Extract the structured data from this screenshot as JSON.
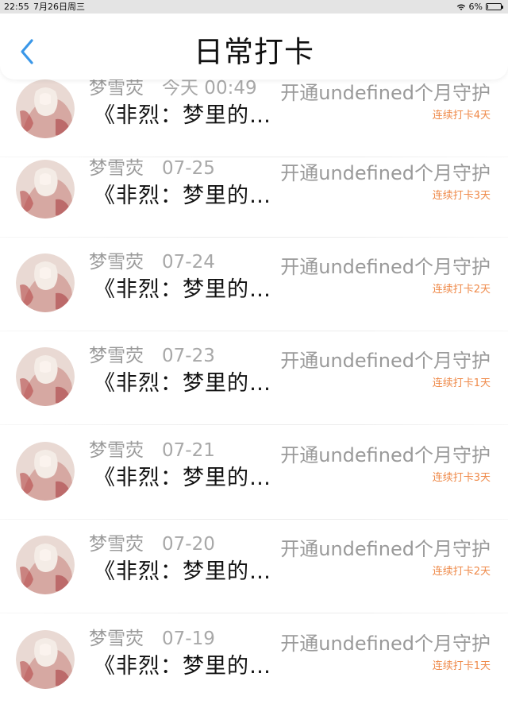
{
  "status_bar": {
    "time": "22:55",
    "date": "7月26日周三",
    "battery": "6%",
    "battery_level": 0.06
  },
  "nav": {
    "title": "日常打卡"
  },
  "entries": [
    {
      "name": "梦雪荧",
      "date": "今天 00:49",
      "title": "《非烈：梦里的…",
      "guard": "开通undefined个月守护",
      "streak": "连续打卡4天"
    },
    {
      "name": "梦雪荧",
      "date": "07-25",
      "title": "《非烈：梦里的…",
      "guard": "开通undefined个月守护",
      "streak": "连续打卡3天"
    },
    {
      "name": "梦雪荧",
      "date": "07-24",
      "title": "《非烈：梦里的…",
      "guard": "开通undefined个月守护",
      "streak": "连续打卡2天"
    },
    {
      "name": "梦雪荧",
      "date": "07-23",
      "title": "《非烈：梦里的…",
      "guard": "开通undefined个月守护",
      "streak": "连续打卡1天"
    },
    {
      "name": "梦雪荧",
      "date": "07-21",
      "title": "《非烈：梦里的…",
      "guard": "开通undefined个月守护",
      "streak": "连续打卡3天"
    },
    {
      "name": "梦雪荧",
      "date": "07-20",
      "title": "《非烈：梦里的…",
      "guard": "开通undefined个月守护",
      "streak": "连续打卡2天"
    },
    {
      "name": "梦雪荧",
      "date": "07-19",
      "title": "《非烈：梦里的…",
      "guard": "开通undefined个月守护",
      "streak": "连续打卡1天"
    }
  ],
  "colors": {
    "accent": "#3a97e8",
    "streak": "#ef8a4a",
    "muted_text": "#9a9a9a"
  },
  "icons": {
    "back": "chevron-left-icon",
    "wifi": "wifi-icon",
    "battery": "battery-icon"
  }
}
